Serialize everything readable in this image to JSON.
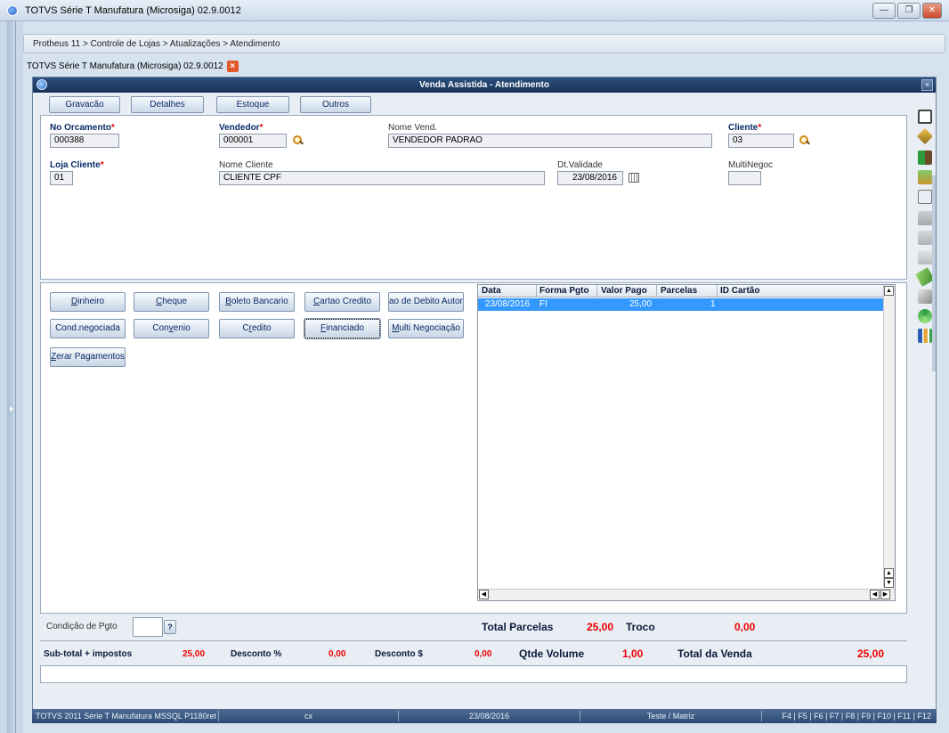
{
  "window": {
    "title": "TOTVS Série T Manufatura (Microsiga) 02.9.0012"
  },
  "breadcrumb": "Protheus 11 > Controle de Lojas > Atualizações > Atendimento",
  "doc_tab": {
    "label": "TOTVS Série T Manufatura (Microsiga) 02.9.0012"
  },
  "dialog": {
    "title": "Venda Assistida - Atendimento",
    "top_buttons": [
      "Gravacão",
      "Detalhes",
      "Estoque",
      "Outros"
    ]
  },
  "header_form": {
    "orcamento": {
      "label": "No Orcamento",
      "value": "000388"
    },
    "vendedor": {
      "label": "Vendedor",
      "value": "000001"
    },
    "nome_vend": {
      "label": "Nome Vend.",
      "value": "VENDEDOR PADRAO"
    },
    "cliente": {
      "label": "Cliente",
      "value": "03"
    },
    "loja_cliente": {
      "label": "Loja Cliente",
      "value": "01"
    },
    "nome_cliente": {
      "label": "Nome Cliente",
      "value": "CLIENTE CPF"
    },
    "dt_validade": {
      "label": "Dt.Validade",
      "value": "23/08/2016"
    },
    "multinegoc": {
      "label": "MultiNegoc",
      "value": ""
    },
    "required_mark": "*"
  },
  "payment_buttons": {
    "dinheiro": {
      "ul": "D",
      "rest": "inheiro"
    },
    "cheque": {
      "ul": "C",
      "rest": "heque"
    },
    "boleto": {
      "ul": "B",
      "rest": "oleto Bancario"
    },
    "cartao_credito": {
      "ul": "C",
      "rest": "artao Credito"
    },
    "debito_auto": "ao de Debito Autom",
    "cond_negociada": "Cond.negociada",
    "convenio": {
      "pre": "Con",
      "ul": "v",
      "rest": "enio"
    },
    "credito": {
      "pre": "C",
      "ul": "r",
      "rest": "edito"
    },
    "financiado": {
      "ul": "F",
      "rest": "inanciado"
    },
    "multi_negociacao": {
      "ul": "M",
      "rest": "ulti Negociação"
    },
    "zerar": {
      "ul": "Z",
      "rest": "erar Pagamentos"
    }
  },
  "grid": {
    "columns": [
      "Data",
      "Forma Pgto",
      "Valor Pago",
      "Parcelas",
      "ID Cartão"
    ],
    "rows": [
      {
        "data": "23/08/2016",
        "forma": "FI",
        "valor": "25,00",
        "parcelas": "1",
        "id_cartao": ""
      }
    ]
  },
  "condicao_pgto": {
    "label": "Condição de Pgto",
    "value": "",
    "help": "?"
  },
  "totals": {
    "total_parcelas_label": "Total Parcelas",
    "total_parcelas_value": "25,00",
    "troco_label": "Troco",
    "troco_value": "0,00"
  },
  "summary": {
    "subtotal_label": "Sub-total + impostos",
    "subtotal_value": "25,00",
    "desconto_pct_label": "Desconto %",
    "desconto_pct_value": "0,00",
    "desconto_val_label": "Desconto $",
    "desconto_val_value": "0,00",
    "qtde_volume_label": "Qtde Volume",
    "qtde_volume_value": "1,00",
    "total_venda_label": "Total da Venda",
    "total_venda_value": "25,00"
  },
  "statusbar": {
    "env": "TOTVS 2011 Série T Manufatura MSSQL P1180ret",
    "user": "cx",
    "date": "23/08/2016",
    "company": "Teste / Matriz",
    "keys": "F4 | F5 | F6 | F7 | F8 | F9 | F10 | F11 | F12"
  },
  "colors": {
    "accent": "#2d4f7c",
    "selection": "#3399ff",
    "required": "#e00000",
    "value_red": "#e00000"
  },
  "right_toolbar_icons": [
    "save-icon",
    "edit-icon",
    "exit-icon",
    "box-icon",
    "document-icon",
    "truck-icon",
    "printer-icon",
    "package-icon",
    "money-icon",
    "key-icon",
    "refresh-icon",
    "chart-icon"
  ]
}
